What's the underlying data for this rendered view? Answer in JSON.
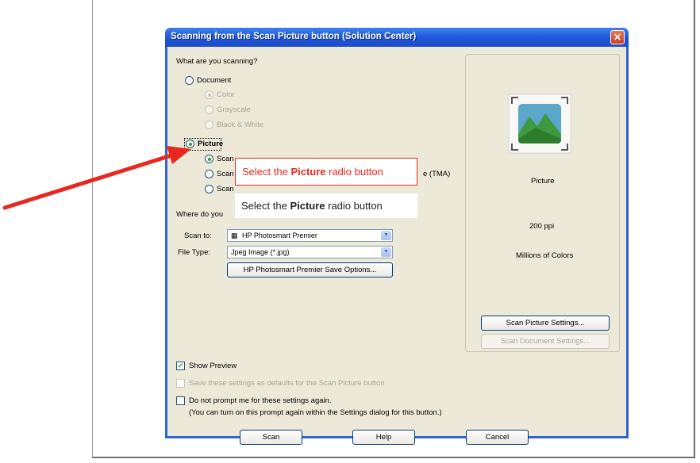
{
  "dialog": {
    "title": "Scanning from the Scan Picture button (Solution Center)",
    "close_glyph": "✕"
  },
  "what_scanning": {
    "label": "What are you scanning?",
    "document": "Document",
    "doc_options": [
      "Color",
      "Grayscale",
      "Black & White"
    ],
    "picture": "Picture",
    "picture_options": [
      "Scan",
      "Scan",
      "Scan"
    ],
    "picture_option2_suffix": "e (TMA)"
  },
  "where": {
    "label": "Where do you",
    "scan_to_label": "Scan to:",
    "scan_to_value": "HP Photosmart Premier",
    "file_type_label": "File Type:",
    "file_type_value": "Jpeg Image (*.jpg)",
    "save_options_button": "HP Photosmart Premier Save Options..."
  },
  "preview": {
    "type_label": "Picture",
    "resolution": "200 ppi",
    "color_depth": "Millions of Colors",
    "scan_picture_settings": "Scan Picture Settings...",
    "scan_document_settings": "Scan Document Settings..."
  },
  "options": {
    "show_preview": "Show Preview",
    "save_defaults": "Save these settings as defaults for the Scan Picture button",
    "do_not_prompt": "Do not prompt me for these settings again.",
    "do_not_prompt_note": "(You can turn on this prompt again within the Settings dialog for this button.)"
  },
  "buttons": {
    "scan": "Scan",
    "help": "Help",
    "cancel": "Cancel"
  },
  "callout": {
    "prefix": "Select the ",
    "bold": "Picture",
    "suffix": " radio button"
  },
  "colors": {
    "arrow": "#e8281f",
    "title_bar": "#1f55d6",
    "dialog_bg": "#ece9d8"
  }
}
